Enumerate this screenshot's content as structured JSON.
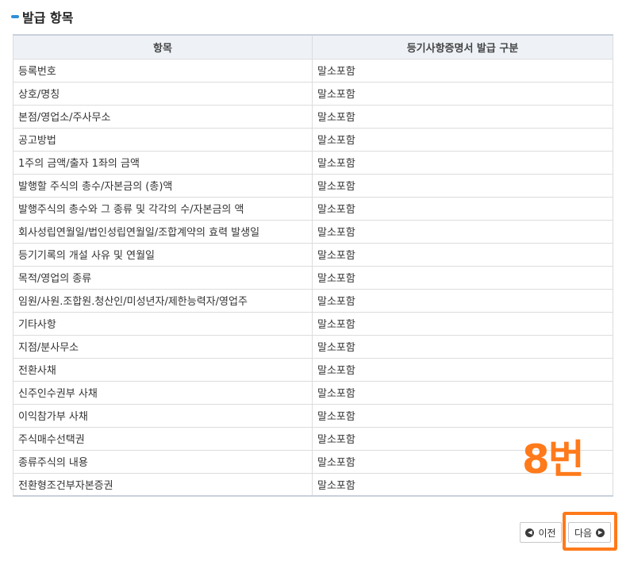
{
  "section": {
    "title": "발급 항목"
  },
  "table": {
    "headers": [
      "항목",
      "등기사항증명서 발급 구분"
    ],
    "rows": [
      [
        "등록번호",
        "말소포함"
      ],
      [
        "상호/명칭",
        "말소포함"
      ],
      [
        "본점/영업소/주사무소",
        "말소포함"
      ],
      [
        "공고방법",
        "말소포함"
      ],
      [
        "1주의 금액/출자 1좌의 금액",
        "말소포함"
      ],
      [
        "발행할 주식의 총수/자본금의 (총)액",
        "말소포함"
      ],
      [
        "발행주식의 총수와 그 종류 및 각각의 수/자본금의 액",
        "말소포함"
      ],
      [
        "회사성립연월일/법인성립연월일/조합계약의 효력 발생일",
        "말소포함"
      ],
      [
        "등기기록의 개설 사유 및 연월일",
        "말소포함"
      ],
      [
        "목적/영업의 종류",
        "말소포함"
      ],
      [
        "임원/사원.조합원.청산인/미성년자/제한능력자/영업주",
        "말소포함"
      ],
      [
        "기타사항",
        "말소포함"
      ],
      [
        "지점/분사무소",
        "말소포함"
      ],
      [
        "전환사채",
        "말소포함"
      ],
      [
        "신주인수권부 사채",
        "말소포함"
      ],
      [
        "이익참가부 사채",
        "말소포함"
      ],
      [
        "주식매수선택권",
        "말소포함"
      ],
      [
        "종류주식의 내용",
        "말소포함"
      ],
      [
        "전환형조건부자본증권",
        "말소포함"
      ]
    ]
  },
  "annotation": {
    "label": "8번",
    "color": "#ff7a1a"
  },
  "nav": {
    "prev_label": "이전",
    "next_label": "다음",
    "prev_icon": "circle-arrow-left-icon",
    "next_icon": "circle-arrow-right-icon"
  },
  "colors": {
    "accent": "#2f8fd8",
    "header_bg": "#eef2f7",
    "highlight": "#ff7a1a"
  }
}
